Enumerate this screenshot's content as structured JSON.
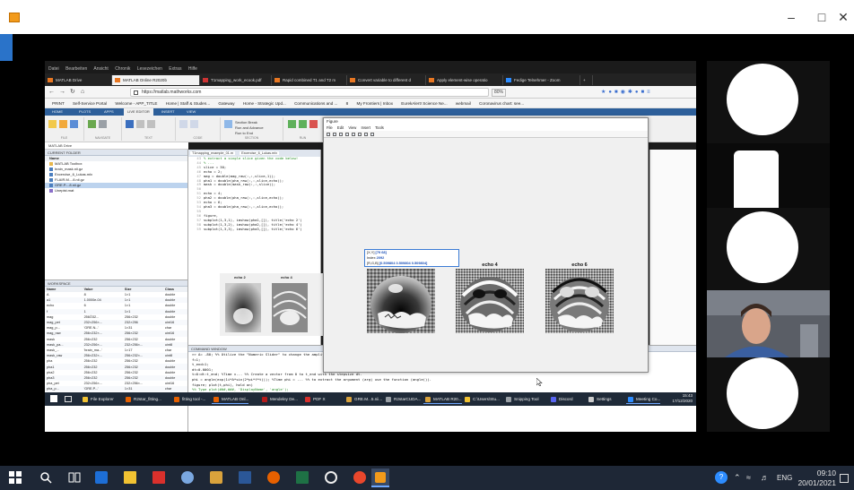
{
  "window": {
    "minimize": "–",
    "maximize": "□",
    "close": "✕"
  },
  "browser": {
    "menu": [
      "Datei",
      "Bearbeiten",
      "Ansicht",
      "Chronik",
      "Lesezeichen",
      "Extras",
      "Hilfe"
    ],
    "tabs": [
      "MATLAB Drive",
      "MATLAB Online R2020b",
      "T1mapping_work_ecook.pdf",
      "Rapid combined T1 and T2 m",
      "Convert variable to different d",
      "Apply element-wise operatio",
      "Fedige Telnehmer - Zoom"
    ],
    "url": "https://matlab.mathworks.com",
    "zoom": "80%",
    "bookmarks": [
      "PRINT",
      "Self-Service Portal",
      "Welcome - APP_TITLE",
      "Home | Staff & Studen...",
      "Gateway",
      "Home - Strategic Upd...",
      "Communications and ...",
      "8",
      "My Frontiers | Inbox",
      "EurekAlert! Science Ne...",
      "webmail",
      "Coronavirus chart: see..."
    ]
  },
  "matlab": {
    "tabs": [
      "HOME",
      "PLOTS",
      "APPS",
      "LIVE EDITOR",
      "INSERT",
      "VIEW"
    ],
    "groups": [
      "FILE",
      "NAVIGATE",
      "TEXT",
      "CODE",
      "SECTION",
      "RUN"
    ],
    "ribbon_text": [
      "Section Break",
      "Run and Advance",
      "Run to End",
      "Run Section",
      "Run",
      "Step",
      "Stop"
    ],
    "address": "MATLAB Drive",
    "current_folder": {
      "title": "CURRENT FOLDER",
      "name_header": "Name",
      "items": [
        "MATLAB Toolbox",
        "brain_mask.nii.gz",
        "Excercise_6_Lukas.mlx",
        "FLAIR.M....8.nii.gz",
        "GRE.P....8.nii.gz",
        "Unepist.mat"
      ]
    },
    "workspace": {
      "title": "WORKSPACE",
      "headers": [
        "Name",
        "Value",
        "Size",
        "Class"
      ],
      "rows": [
        [
          "A",
          "8",
          "1×1",
          "double"
        ],
        [
          "a1",
          "1.0000e-04",
          "1×1",
          "double"
        ],
        [
          "echo",
          "6",
          "1×1",
          "double"
        ],
        [
          "f",
          "1",
          "1×1",
          "double"
        ],
        [
          "mag",
          "256Ò32...",
          "256×232",
          "double"
        ],
        [
          "mag_pet",
          "232×256×...",
          "232×256",
          "uint16"
        ],
        [
          "mag_p...",
          "'GRE.N...'",
          "1×31",
          "char"
        ],
        [
          "mag_raw",
          "256×232×...",
          "256×232",
          "uint16"
        ],
        [
          "mask",
          "256×232",
          "256×232",
          "double"
        ],
        [
          "mask_pa...",
          "232×256×...",
          "232×256×...",
          "uint8"
        ],
        [
          "mask_...",
          "'brain_ma...'",
          "1×17",
          "char"
        ],
        [
          "mask_raw",
          "256×232×...",
          "256×232×...",
          "uint8"
        ],
        [
          "pha",
          "256×232",
          "256×232",
          "double"
        ],
        [
          "pha1",
          "256×232",
          "256×232",
          "double"
        ],
        [
          "pha2",
          "256×232",
          "256×232",
          "double"
        ],
        [
          "pha3",
          "256×232",
          "256×232",
          "double"
        ],
        [
          "pha_pet",
          "232×256×...",
          "232×256×...",
          "uint16"
        ],
        [
          "pha_p...",
          "'GRE.P...'",
          "1×31",
          "char"
        ],
        [
          "pha_raw",
          "256×232×...",
          "256×232×...",
          "uint16"
        ]
      ]
    },
    "editor": {
      "tabs": [
        "T1mapping_example_01.m",
        "Excercise_6_Lukas.mlx"
      ],
      "lines": [
        [
          "43",
          "% extract a single slice given the code below!"
        ],
        [
          "44",
          "% ..."
        ],
        [
          "45",
          "slice = 30;"
        ],
        [
          "46",
          "echo = 2;"
        ],
        [
          "47",
          "mag = double(mag_raw(:,:,slice,1));"
        ],
        [
          "48",
          "pha1 = double(pha_raw(:,:,slice,echo));"
        ],
        [
          "49",
          "mask = double(mask_raw(:,:,slice));"
        ],
        [
          "50",
          ""
        ],
        [
          "51",
          "echo = 4;"
        ],
        [
          "52",
          "pha2 = double(pha_raw(:,:,slice,echo));"
        ],
        [
          "53",
          "echo = 6;"
        ],
        [
          "54",
          "pha3 = double(pha_raw(:,:,slice,echo));"
        ],
        [
          "55",
          ""
        ],
        [
          "56",
          "figure,"
        ],
        [
          "57",
          "subplot(1,3,1), imshow(pha1,[]), title('echo 2')"
        ],
        [
          "58",
          "subplot(1,3,2), imshow(pha2,[]), title('echo 4')"
        ],
        [
          "59",
          "subplot(1,3,3), imshow(pha3,[]), title('echo 6')"
        ]
      ],
      "mini_titles": [
        "echo 2",
        "echo 4"
      ]
    },
    "command_window": {
      "title": "COMMAND WINDOW",
      "lines": [
        [
          ">> A= -80; %% Utilize the \"Numeric Slider\" to change the amplitude",
          false
        ],
        [
          "f=1;",
          false
        ],
        [
          "t_end=1;",
          false
        ],
        [
          "dt=0.0001;",
          false
        ],
        [
          "t=0:dt:t_end; %Time v... %% Create a vector from 0 to t_end with the stepsize dt.",
          false
        ],
        [
          "phi = angle(exp(1i*A*sin(2*pi*f*t))); %Time phi = ... %% to extract the argument (arg) use the function (angle()).",
          false
        ],
        [
          "figure; plot(t,phi), hold on)",
          false
        ],
        [
          "",
          false
        ],
        [
          "%% Type plot(###,###, 'DisplayName', 'angle');",
          true
        ],
        [
          "plot(t, unwrap(phi), 'DisplayName', 'unwrap(angle)');",
          false
        ],
        [
          ">>",
          false
        ]
      ]
    },
    "figure": {
      "title": "Figure",
      "menu": [
        "File",
        "Edit",
        "View",
        "Insert",
        "Tools"
      ],
      "panels": [
        "echo 2",
        "echo 4",
        "echo 6"
      ],
      "datatip": {
        "xy_label": "[X,Y]",
        "xy": "[79 68]",
        "index_label": "Index",
        "index": "2092",
        "rgb_label": "[R,G,B]",
        "rgb": "[0.509804 0.509804 0.509804]"
      }
    }
  },
  "remote_taskbar": {
    "items": [
      "File Explorer",
      "R2star_fitting...",
      "fitting tool -...",
      "MATLAB Onl...",
      "Mendeley De...",
      "PDF X",
      "GRE.M...5.nii...",
      "R2starCUDA...",
      "MATLAB R20...",
      "C:\\Users\\Stu...",
      "Snipping Tool",
      "Discord",
      "Settings",
      "Meeting Co..."
    ],
    "time": "15:43",
    "date": "17/12/2020"
  },
  "taskbar": {
    "lang": "ENG",
    "time": "09:10",
    "date": "20/01/2021"
  },
  "colors": {
    "taskbar": "#1e2736",
    "matlab_blue": "#2d5f9a",
    "accent": "#2a73c9"
  }
}
